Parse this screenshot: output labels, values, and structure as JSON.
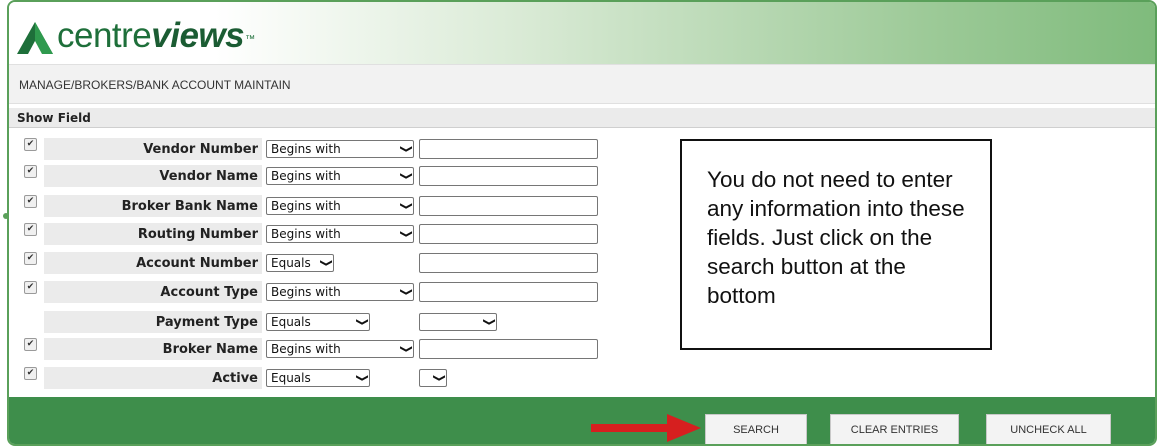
{
  "header": {
    "logo_text_light": "centre",
    "logo_text_bold": "views",
    "logo_tm": "™",
    "logo_icon": "green-triangle-logo"
  },
  "breadcrumb": "MANAGE/BROKERS/BANK ACCOUNT MAINTAIN",
  "show_field_label": "Show Field",
  "fields": [
    {
      "label": "Vendor Number",
      "checked": true,
      "operator": "Begins with",
      "value": ""
    },
    {
      "label": "Vendor Name",
      "checked": true,
      "operator": "Begins with",
      "value": ""
    },
    {
      "label": "Broker Bank Name",
      "checked": true,
      "operator": "Begins with",
      "value": ""
    },
    {
      "label": "Routing Number",
      "checked": true,
      "operator": "Begins with",
      "value": ""
    },
    {
      "label": "Account Number",
      "checked": true,
      "operator": "Equals",
      "value": ""
    },
    {
      "label": "Account Type",
      "checked": true,
      "operator": "Begins with",
      "value": ""
    },
    {
      "label": "Payment Type",
      "checked": false,
      "operator": "Equals",
      "value": ""
    },
    {
      "label": "Broker Name",
      "checked": true,
      "operator": "Begins with",
      "value": ""
    },
    {
      "label": "Active",
      "checked": true,
      "operator": "Equals",
      "value": ""
    }
  ],
  "notice": {
    "text": "You do not need to enter any information into these fields. Just click on the search button at the bottom"
  },
  "footer": {
    "search_label": "SEARCH",
    "clear_label": "CLEAR ENTRIES",
    "uncheck_label": "UNCHECK ALL"
  },
  "colors": {
    "brand_green": "#3e8e4b",
    "logo_green": "#1e6f3a",
    "arrow_red": "#d61f1f"
  }
}
